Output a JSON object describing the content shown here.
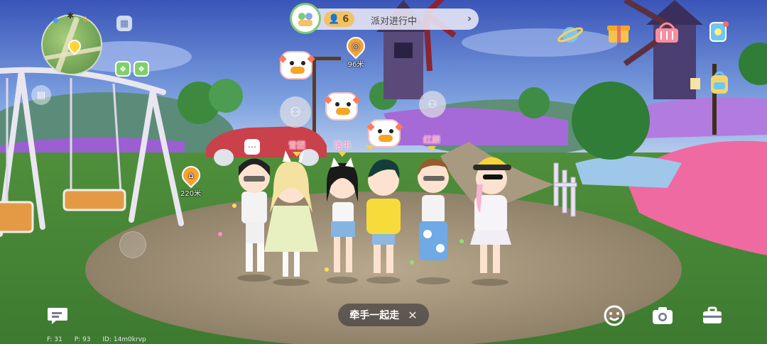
{
  "hud": {
    "party": {
      "member_count": "6",
      "label": "派对进行中",
      "arrow": "›"
    },
    "distance_pins": [
      {
        "label": "96米",
        "icon": "location-target-icon"
      },
      {
        "label": "220米",
        "icon": "home-pin-icon"
      }
    ],
    "walk_together": {
      "label": "牵手一起走",
      "close": "✕"
    },
    "debug": {
      "f": "F: 31",
      "p": "P: 93",
      "id": "ID: 14m0krvp"
    }
  },
  "players": [
    {
      "name": "雪团"
    },
    {
      "name": "落书"
    },
    {
      "name": "红颜"
    }
  ],
  "icons": {
    "top_right": [
      "planet-icon",
      "gift-box-icon",
      "shop-basket-icon",
      "smartwatch-icon",
      "backpack-icon"
    ],
    "bottom": [
      "chat-icon",
      "emote-icon",
      "camera-icon",
      "toolbox-icon"
    ]
  },
  "colors": {
    "party_green": "#7fc97a",
    "pin_orange": "#f3a33a",
    "name_pink": "#ff7fb0",
    "lavender": "#b27be0"
  }
}
